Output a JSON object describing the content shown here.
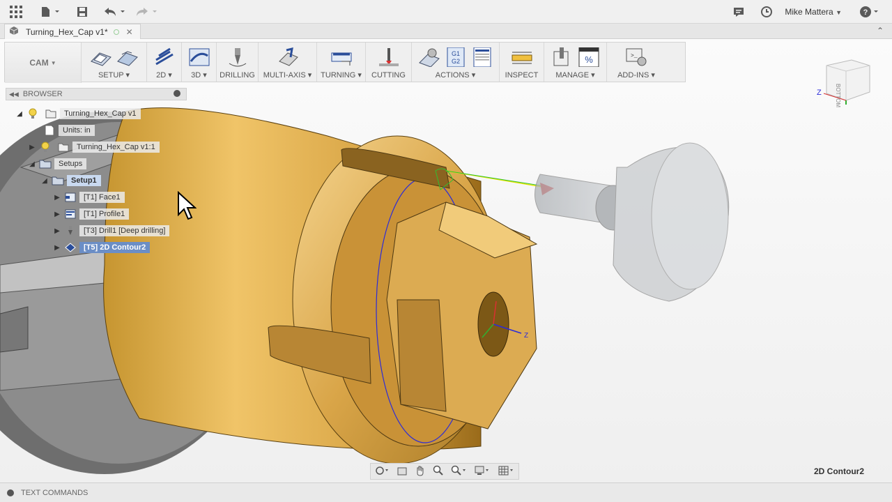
{
  "titlebar": {
    "user": "Mike Mattera"
  },
  "document": {
    "tab_title": "Turning_Hex_Cap v1*"
  },
  "toolbar": {
    "workspace": "CAM",
    "groups": [
      {
        "label": "SETUP",
        "dropdown": true
      },
      {
        "label": "2D",
        "dropdown": true
      },
      {
        "label": "3D",
        "dropdown": true
      },
      {
        "label": "DRILLING",
        "dropdown": false
      },
      {
        "label": "MULTI-AXIS",
        "dropdown": true
      },
      {
        "label": "TURNING",
        "dropdown": true
      },
      {
        "label": "CUTTING",
        "dropdown": false
      },
      {
        "label": "ACTIONS",
        "dropdown": true
      },
      {
        "label": "INSPECT",
        "dropdown": false
      },
      {
        "label": "MANAGE",
        "dropdown": true
      },
      {
        "label": "ADD-INS",
        "dropdown": true
      }
    ],
    "g1g2_text": "G1\nG2",
    "percent_text": "%"
  },
  "browser": {
    "title": "BROWSER",
    "items": [
      {
        "label": "Turning_Hex_Cap v1"
      },
      {
        "label": "Units: in"
      },
      {
        "label": "Turning_Hex_Cap v1:1"
      },
      {
        "label": "Setups"
      },
      {
        "label": "Setup1"
      },
      {
        "label": "[T1] Face1"
      },
      {
        "label": "[T1] Profile1"
      },
      {
        "label": "[T3] Drill1 [Deep drilling]"
      },
      {
        "label": "[T5] 2D Contour2"
      }
    ]
  },
  "viewcube": {
    "face_label": "BOTTOM",
    "axis_label": "Z"
  },
  "viewport": {
    "axis_z_label": "Z",
    "active_operation": "2D Contour2"
  },
  "statusbar": {
    "label": "TEXT COMMANDS"
  }
}
